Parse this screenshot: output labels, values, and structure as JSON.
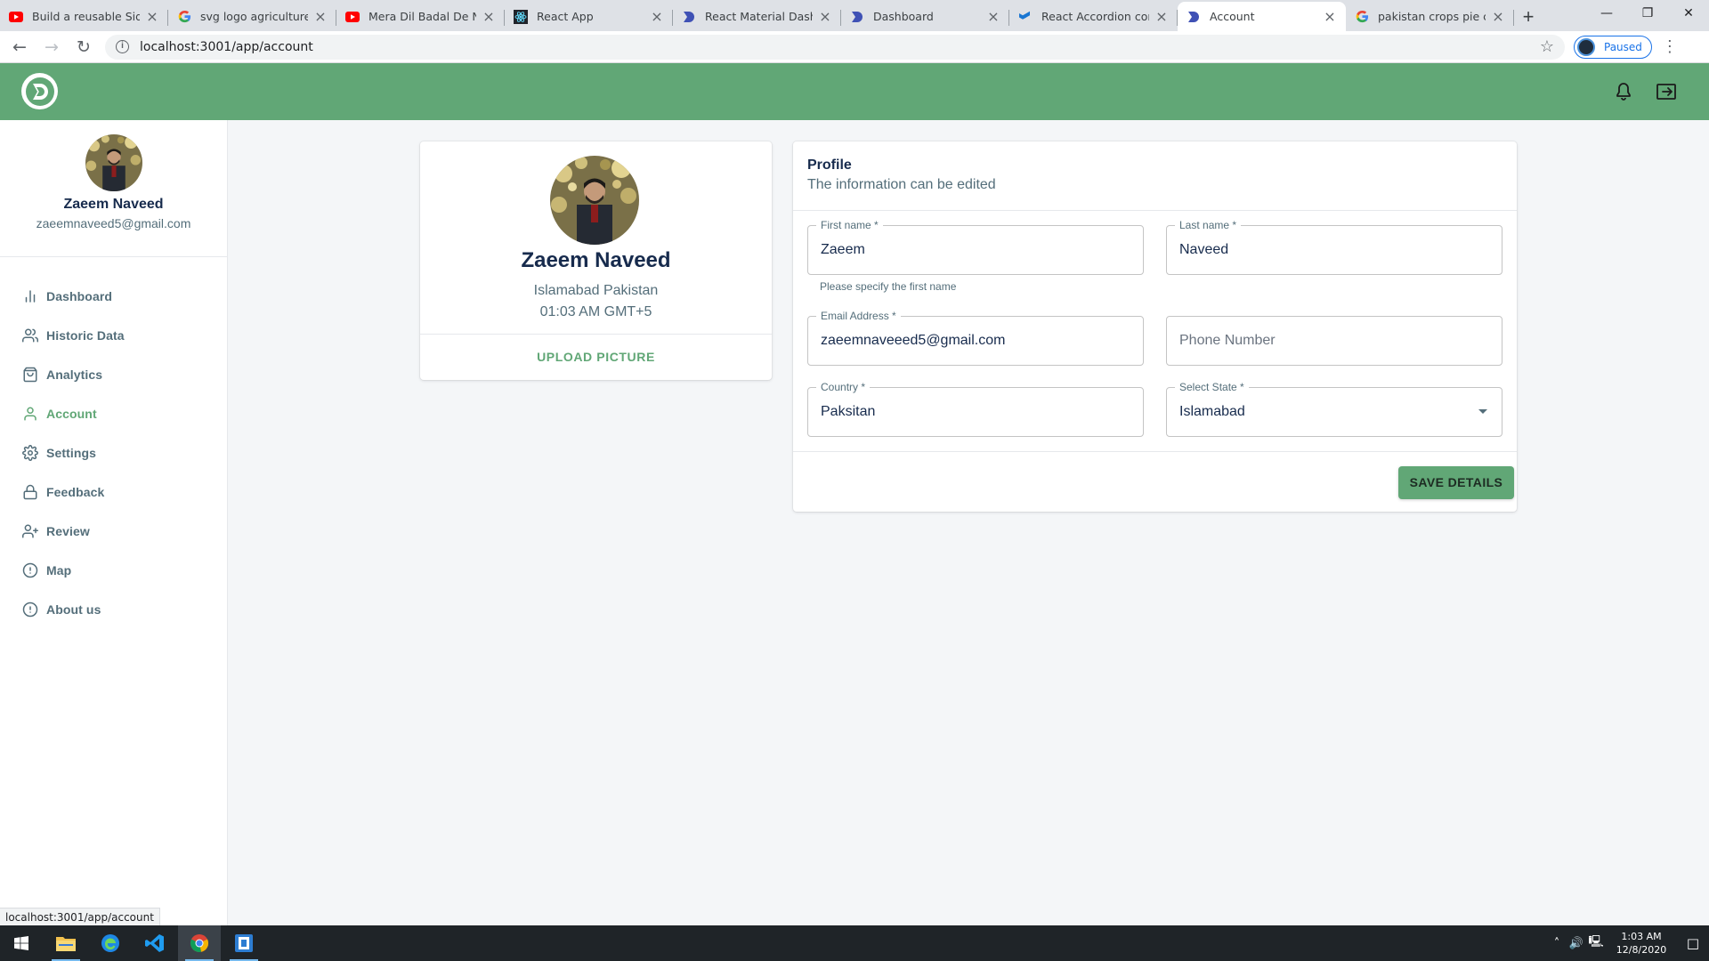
{
  "browser": {
    "tabs": [
      {
        "title": "Build a reusable Sideba",
        "icon": "youtube-icon"
      },
      {
        "title": "svg logo agriculture - G",
        "icon": "google-icon"
      },
      {
        "title": "Mera Dil Badal De Naat",
        "icon": "youtube-icon"
      },
      {
        "title": "React App",
        "icon": "react-icon"
      },
      {
        "title": "React Material Dashbo",
        "icon": "devias-icon"
      },
      {
        "title": "Dashboard",
        "icon": "devias-icon"
      },
      {
        "title": "React Accordion compo",
        "icon": "material-ui-icon"
      },
      {
        "title": "Account",
        "icon": "devias-icon",
        "active": true
      },
      {
        "title": "pakistan crops pie char",
        "icon": "google-icon"
      }
    ],
    "url": "localhost:3001/app/account",
    "profile_status": "Paused",
    "status_url": "localhost:3001/app/account"
  },
  "appbar": {
    "color": "#61a776",
    "logo_icon": "app-logo-icon",
    "bell_icon": "bell-icon",
    "logout_icon": "logout-icon"
  },
  "sidebar": {
    "user_name": "Zaeem Naveed",
    "user_email": "zaeemnaveed5@gmail.com",
    "items": [
      {
        "label": "Dashboard",
        "icon": "bar-chart-icon"
      },
      {
        "label": "Historic Data",
        "icon": "users-icon"
      },
      {
        "label": "Analytics",
        "icon": "shopping-bag-icon"
      },
      {
        "label": "Account",
        "icon": "user-icon",
        "active": true
      },
      {
        "label": "Settings",
        "icon": "settings-icon"
      },
      {
        "label": "Feedback",
        "icon": "lock-icon"
      },
      {
        "label": "Review",
        "icon": "user-plus-icon"
      },
      {
        "label": "Map",
        "icon": "alert-circle-icon"
      },
      {
        "label": "About us",
        "icon": "alert-circle-icon"
      }
    ]
  },
  "profile_card": {
    "name": "Zaeem Naveed",
    "location": "Islamabad Pakistan",
    "time": "01:03 AM GMT+5",
    "upload_label": "UPLOAD PICTURE"
  },
  "details": {
    "title": "Profile",
    "subtitle": "The information can be edited",
    "first_name": {
      "label": "First name *",
      "value": "Zaeem",
      "helper": "Please specify the first name"
    },
    "last_name": {
      "label": "Last name *",
      "value": "Naveed"
    },
    "email": {
      "label": "Email Address *",
      "value": "zaeemnaveeed5@gmail.com"
    },
    "phone": {
      "placeholder": "Phone Number",
      "value": ""
    },
    "country": {
      "label": "Country *",
      "value": "Paksitan"
    },
    "state": {
      "label": "Select State *",
      "value": "Islamabad"
    },
    "save_label": "SAVE DETAILS"
  },
  "taskbar": {
    "apps": [
      "windows-start-icon",
      "file-explorer-icon",
      "edge-icon",
      "vscode-icon",
      "chrome-icon",
      "app-icon"
    ],
    "time": "1:03 AM",
    "date": "12/8/2020"
  }
}
